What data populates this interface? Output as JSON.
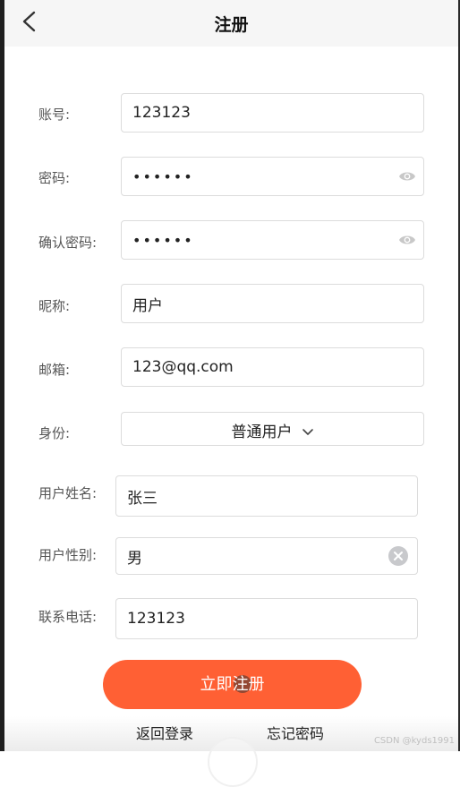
{
  "header": {
    "title": "注册"
  },
  "form": {
    "account": {
      "label": "账号:",
      "value": "123123"
    },
    "password": {
      "label": "密码:",
      "value": "123123"
    },
    "confirm_password": {
      "label": "确认密码:",
      "value": "123123"
    },
    "nickname": {
      "label": "昵称:",
      "value": "用户"
    },
    "email": {
      "label": "邮箱:",
      "value": "123@qq.com"
    },
    "identity": {
      "label": "身份:",
      "value": "普通用户"
    },
    "real_name": {
      "label": "用户姓名:",
      "value": "张三"
    },
    "gender": {
      "label": "用户性别:",
      "value": "男"
    },
    "phone": {
      "label": "联系电话:",
      "value": "123123"
    }
  },
  "actions": {
    "submit_label": "立即注册",
    "back_login_label": "返回登录",
    "forgot_password_label": "忘记密码"
  },
  "watermark": "CSDN @kyds1991",
  "colors": {
    "accent": "#ff6034",
    "border": "#dcdcdc",
    "label": "#555555"
  },
  "icons": {
    "back": "chevron-left-icon",
    "password_toggle": "eye-icon",
    "dropdown": "chevron-down-icon",
    "clear": "clear-circle-icon"
  }
}
